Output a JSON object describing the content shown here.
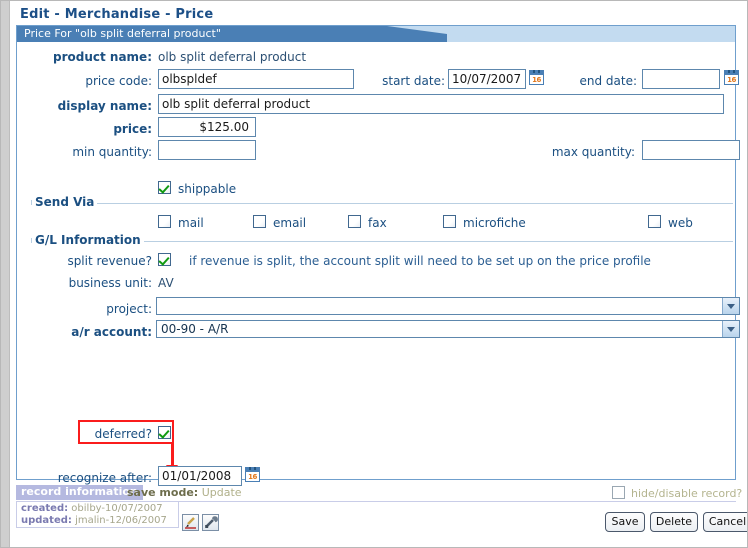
{
  "title": "Edit - Merchandise - Price",
  "panel": {
    "header": "Price For \"olb split deferral product\""
  },
  "form": {
    "product_name": {
      "label": "product name:",
      "value": "olb split deferral product"
    },
    "price_code": {
      "label": "price code:",
      "value": "olbspldef"
    },
    "start_date": {
      "label": "start date:",
      "value": "10/07/2007",
      "icon": "calendar-icon"
    },
    "end_date": {
      "label": "end date:",
      "value": "",
      "icon": "calendar-icon"
    },
    "display_name": {
      "label": "display name:",
      "value": "olb split deferral product"
    },
    "price": {
      "label": "price:",
      "value": "$125.00"
    },
    "min_quantity": {
      "label": "min quantity:",
      "value": ""
    },
    "max_quantity": {
      "label": "max quantity:",
      "value": ""
    },
    "shippable": {
      "label": "shippable",
      "checked": true
    }
  },
  "send_via": {
    "legend": "Send Via",
    "options": [
      {
        "label": "mail",
        "checked": false
      },
      {
        "label": "email",
        "checked": false
      },
      {
        "label": "fax",
        "checked": false
      },
      {
        "label": "microfiche",
        "checked": false
      },
      {
        "label": "web",
        "checked": false
      }
    ]
  },
  "gl": {
    "legend": "G/L Information",
    "split_revenue": {
      "label": "split revenue?",
      "checked": true,
      "hint": "if revenue is split, the account split will need to be set up on the price profile"
    },
    "business_unit": {
      "label": "business unit:",
      "value": "AV"
    },
    "project": {
      "label": "project:",
      "value": ""
    },
    "ar_account": {
      "label": "a/r account:",
      "value": "00-90 - A/R"
    }
  },
  "deferred": {
    "label": "deferred?",
    "checked": true,
    "recognize_after": {
      "label": "recognize after:",
      "value": "01/01/2008",
      "icon": "calendar-icon"
    },
    "annotation_color": "#fa1c1c"
  },
  "record_info": {
    "tab": "record information",
    "save_mode_label": "save mode:",
    "save_mode_value": "Update",
    "created_label": "created:",
    "created_value": "obilby-10/07/2007",
    "updated_label": "updated:",
    "updated_value": "jmalin-12/06/2007",
    "icons": [
      "edit-pencil-icon",
      "wrench-icon"
    ]
  },
  "footer": {
    "hide_disable": {
      "label": "hide/disable record?",
      "checked": false
    },
    "buttons": [
      {
        "label": "Save"
      },
      {
        "label": "Delete"
      },
      {
        "label": "Cancel"
      }
    ]
  },
  "colors": {
    "header_blue": "#4a7fb5",
    "header_light": "#c3dbf0",
    "label_blue": "#1b4f81",
    "annotation_red": "#fa1c1c",
    "check_green": "#119a11",
    "calendar_orange": "#e1761b"
  }
}
